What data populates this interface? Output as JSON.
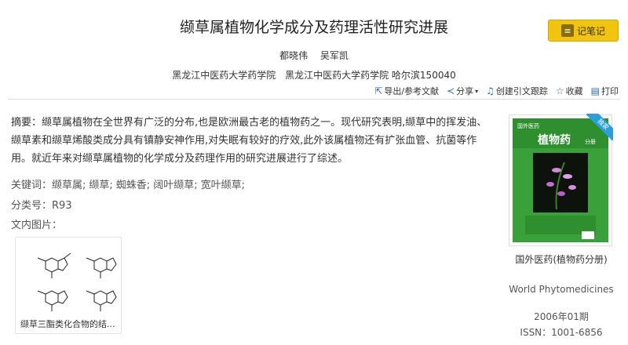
{
  "article": {
    "title": "缬草属植物化学成分及药理活性研究进展",
    "authors": [
      "都晓伟",
      "吴军凯"
    ],
    "affiliations": [
      "黑龙江中医药大学药学院",
      "黑龙江中医药大学药学院 哈尔滨150040"
    ],
    "abstract_label": "摘要：",
    "abstract": "缬草属植物在全世界有广泛的分布,也是欧洲最古老的植物药之一。现代研究表明,缬草中的挥发油、缬草素和缬草烯酸类成分具有镇静安神作用,对失眠有较好的疗效,此外该属植物还有扩张血管、抗菌等作用。就近年来对缬草属植物的化学成分及药理作用的研究进展进行了综述。",
    "keywords_label": "关键词：",
    "keywords": [
      "缬草属;",
      "缬草;",
      "蜘蛛香;",
      "阔叶缬草;",
      "宽叶缬草;"
    ],
    "class_label": "分类号：",
    "class_value": "R93",
    "figures_label": "文内图片：",
    "figure_caption": "缬草三酯类化合物的结..."
  },
  "toolbar": {
    "note_label": "记笔记",
    "export": "导出/参考文献",
    "share": "分享",
    "cite_track": "创建引文跟踪",
    "favorite": "收藏",
    "print": "打印"
  },
  "journal": {
    "badge": "独家",
    "cover_header": "国外医药",
    "cover_title": "植物药",
    "cover_sub": "分册",
    "name_cn": "国外医药(植物药分册)",
    "name_en": "World Phytomedicines",
    "issue": "2006年01期",
    "issn": "ISSN：1001-6856"
  },
  "colors": {
    "accent_yellow": "#f1c40f",
    "link_blue": "#2a6bb3",
    "cover_green": "#3aa03a"
  }
}
